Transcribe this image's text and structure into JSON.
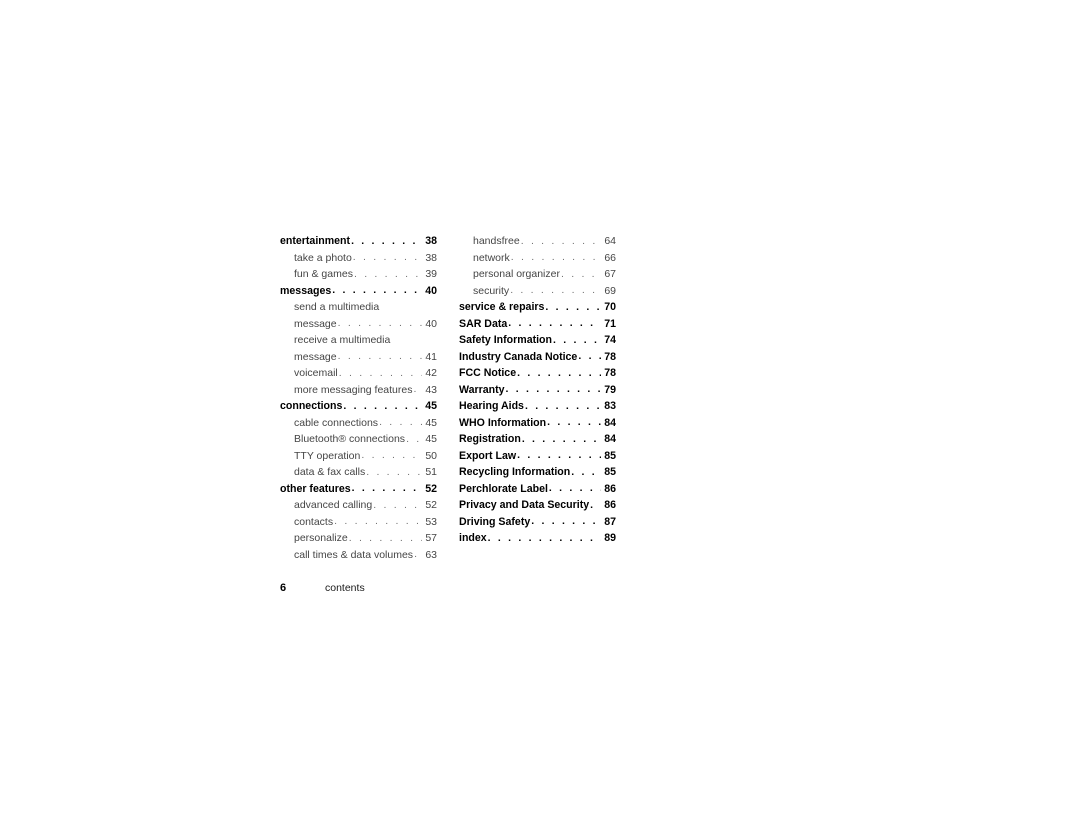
{
  "document": {
    "running_head": "contents",
    "folio": "6"
  },
  "toc": {
    "left_column": [
      {
        "level": 1,
        "label": "entertainment",
        "page": "38"
      },
      {
        "level": 2,
        "label": "take a photo",
        "page": "38"
      },
      {
        "level": 2,
        "label": "fun & games",
        "page": "39"
      },
      {
        "level": 1,
        "label": "messages",
        "page": "40"
      },
      {
        "level": 2,
        "label": "send a multimedia",
        "page": "",
        "continued": true
      },
      {
        "level": 2,
        "label": "message",
        "page": "40"
      },
      {
        "level": 2,
        "label": "receive a multimedia",
        "page": "",
        "continued": true
      },
      {
        "level": 2,
        "label": "message",
        "page": "41"
      },
      {
        "level": 2,
        "label": "voicemail",
        "page": "42"
      },
      {
        "level": 2,
        "label": "more messaging features",
        "page": "43"
      },
      {
        "level": 1,
        "label": "connections",
        "page": "45"
      },
      {
        "level": 2,
        "label": "cable connections",
        "page": "45"
      },
      {
        "level": 2,
        "label": "Bluetooth® connections",
        "page": "45"
      },
      {
        "level": 2,
        "label": "TTY operation",
        "page": "50"
      },
      {
        "level": 2,
        "label": "data & fax calls",
        "page": "51"
      },
      {
        "level": 1,
        "label": "other features",
        "page": "52"
      },
      {
        "level": 2,
        "label": "advanced calling",
        "page": "52"
      },
      {
        "level": 2,
        "label": "contacts",
        "page": "53"
      },
      {
        "level": 2,
        "label": "personalize",
        "page": "57"
      },
      {
        "level": 2,
        "label": "call times & data volumes",
        "page": "63"
      }
    ],
    "right_column": [
      {
        "level": 2,
        "label": "handsfree",
        "page": "64"
      },
      {
        "level": 2,
        "label": "network",
        "page": "66"
      },
      {
        "level": 2,
        "label": "personal organizer",
        "page": "67"
      },
      {
        "level": 2,
        "label": "security",
        "page": "69"
      },
      {
        "level": 1,
        "label": "service & repairs",
        "page": "70"
      },
      {
        "level": 1,
        "label": "SAR Data",
        "page": "71"
      },
      {
        "level": 1,
        "label": "Safety Information",
        "page": "74"
      },
      {
        "level": 1,
        "label": "Industry Canada Notice",
        "page": "78"
      },
      {
        "level": 1,
        "label": "FCC Notice",
        "page": "78"
      },
      {
        "level": 1,
        "label": "Warranty",
        "page": "79"
      },
      {
        "level": 1,
        "label": "Hearing Aids",
        "page": "83"
      },
      {
        "level": 1,
        "label": "WHO Information",
        "page": "84"
      },
      {
        "level": 1,
        "label": "Registration",
        "page": "84"
      },
      {
        "level": 1,
        "label": "Export Law",
        "page": "85"
      },
      {
        "level": 1,
        "label": "Recycling Information",
        "page": "85"
      },
      {
        "level": 1,
        "label": "Perchlorate Label",
        "page": "86"
      },
      {
        "level": 1,
        "label": "Privacy and Data Security",
        "page": "86"
      },
      {
        "level": 1,
        "label": "Driving Safety",
        "page": "87"
      },
      {
        "level": 1,
        "label": "index",
        "page": "89"
      }
    ],
    "leader_char": "."
  }
}
